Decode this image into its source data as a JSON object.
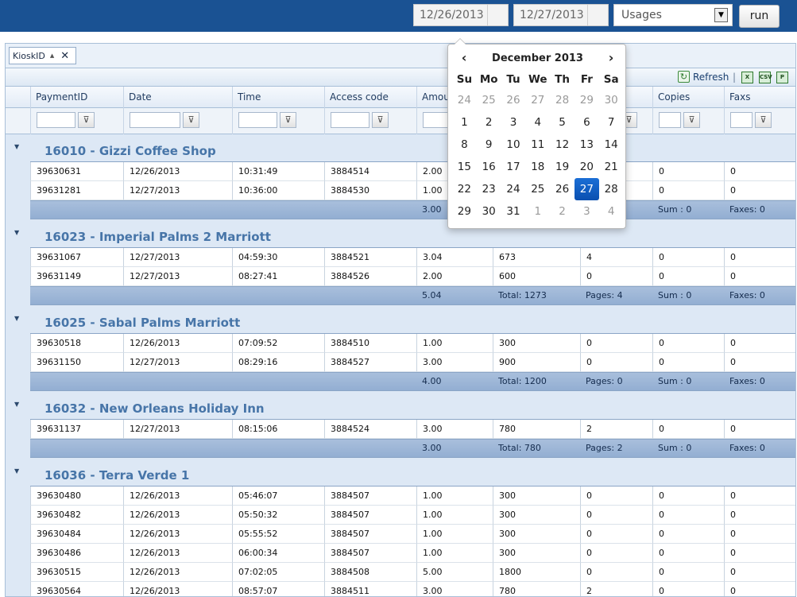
{
  "toolbar": {
    "start_date": "12/26/2013",
    "end_date": "12/27/2013",
    "report_type": "Usages",
    "run_label": "run"
  },
  "grouping": {
    "chip_label": "KioskID"
  },
  "grid_toolbar": {
    "refresh_label": "Refresh",
    "separator": "|",
    "export_icons": [
      "excel-export-icon",
      "csv-export-icon",
      "pdf-export-icon"
    ]
  },
  "columns": [
    "PaymentID",
    "Date",
    "Time",
    "Access code",
    "Amou",
    "",
    "",
    "Copies",
    "Faxs"
  ],
  "groups": [
    {
      "title": "16010 - Gizzi Coffee Shop",
      "rows": [
        [
          "39630631",
          "12/26/2013",
          "10:31:49",
          "3884514",
          "2.00",
          "",
          "",
          "0",
          "0"
        ],
        [
          "39631281",
          "12/27/2013",
          "10:36:00",
          "3884530",
          "1.00",
          "",
          "",
          "0",
          "0"
        ]
      ],
      "footer": [
        "3.00",
        "",
        "",
        "Sum : 0",
        "Faxes: 0"
      ]
    },
    {
      "title": "16023 - Imperial Palms 2 Marriott",
      "rows": [
        [
          "39631067",
          "12/27/2013",
          "04:59:30",
          "3884521",
          "3.04",
          "673",
          "4",
          "0",
          "0"
        ],
        [
          "39631149",
          "12/27/2013",
          "08:27:41",
          "3884526",
          "2.00",
          "600",
          "0",
          "0",
          "0"
        ]
      ],
      "footer": [
        "5.04",
        "Total: 1273",
        "Pages: 4",
        "Sum : 0",
        "Faxes: 0"
      ]
    },
    {
      "title": "16025 - Sabal Palms Marriott",
      "rows": [
        [
          "39630518",
          "12/26/2013",
          "07:09:52",
          "3884510",
          "1.00",
          "300",
          "0",
          "0",
          "0"
        ],
        [
          "39631150",
          "12/27/2013",
          "08:29:16",
          "3884527",
          "3.00",
          "900",
          "0",
          "0",
          "0"
        ]
      ],
      "footer": [
        "4.00",
        "Total: 1200",
        "Pages: 0",
        "Sum : 0",
        "Faxes: 0"
      ]
    },
    {
      "title": "16032 - New Orleans Holiday Inn",
      "rows": [
        [
          "39631137",
          "12/27/2013",
          "08:15:06",
          "3884524",
          "3.00",
          "780",
          "2",
          "0",
          "0"
        ]
      ],
      "footer": [
        "3.00",
        "Total: 780",
        "Pages: 2",
        "Sum : 0",
        "Faxes: 0"
      ]
    },
    {
      "title": "16036 - Terra Verde 1",
      "rows": [
        [
          "39630480",
          "12/26/2013",
          "05:46:07",
          "3884507",
          "1.00",
          "300",
          "0",
          "0",
          "0"
        ],
        [
          "39630482",
          "12/26/2013",
          "05:50:32",
          "3884507",
          "1.00",
          "300",
          "0",
          "0",
          "0"
        ],
        [
          "39630484",
          "12/26/2013",
          "05:55:52",
          "3884507",
          "1.00",
          "300",
          "0",
          "0",
          "0"
        ],
        [
          "39630486",
          "12/26/2013",
          "06:00:34",
          "3884507",
          "1.00",
          "300",
          "0",
          "0",
          "0"
        ],
        [
          "39630515",
          "12/26/2013",
          "07:02:05",
          "3884508",
          "5.00",
          "1800",
          "0",
          "0",
          "0"
        ],
        [
          "39630564",
          "12/26/2013",
          "08:57:07",
          "3884511",
          "3.00",
          "780",
          "2",
          "0",
          "0"
        ]
      ],
      "footer": null
    }
  ],
  "calendar": {
    "prev": "‹",
    "next": "›",
    "title": "December 2013",
    "weekdays": [
      "Su",
      "Mo",
      "Tu",
      "We",
      "Th",
      "Fr",
      "Sa"
    ],
    "weeks": [
      [
        "24",
        "25",
        "26",
        "27",
        "28",
        "29",
        "30"
      ],
      [
        "1",
        "2",
        "3",
        "4",
        "5",
        "6",
        "7"
      ],
      [
        "8",
        "9",
        "10",
        "11",
        "12",
        "13",
        "14"
      ],
      [
        "15",
        "16",
        "17",
        "18",
        "19",
        "20",
        "21"
      ],
      [
        "22",
        "23",
        "24",
        "25",
        "26",
        "27",
        "28"
      ],
      [
        "29",
        "30",
        "31",
        "1",
        "2",
        "3",
        "4"
      ]
    ],
    "selected_day": "27"
  }
}
